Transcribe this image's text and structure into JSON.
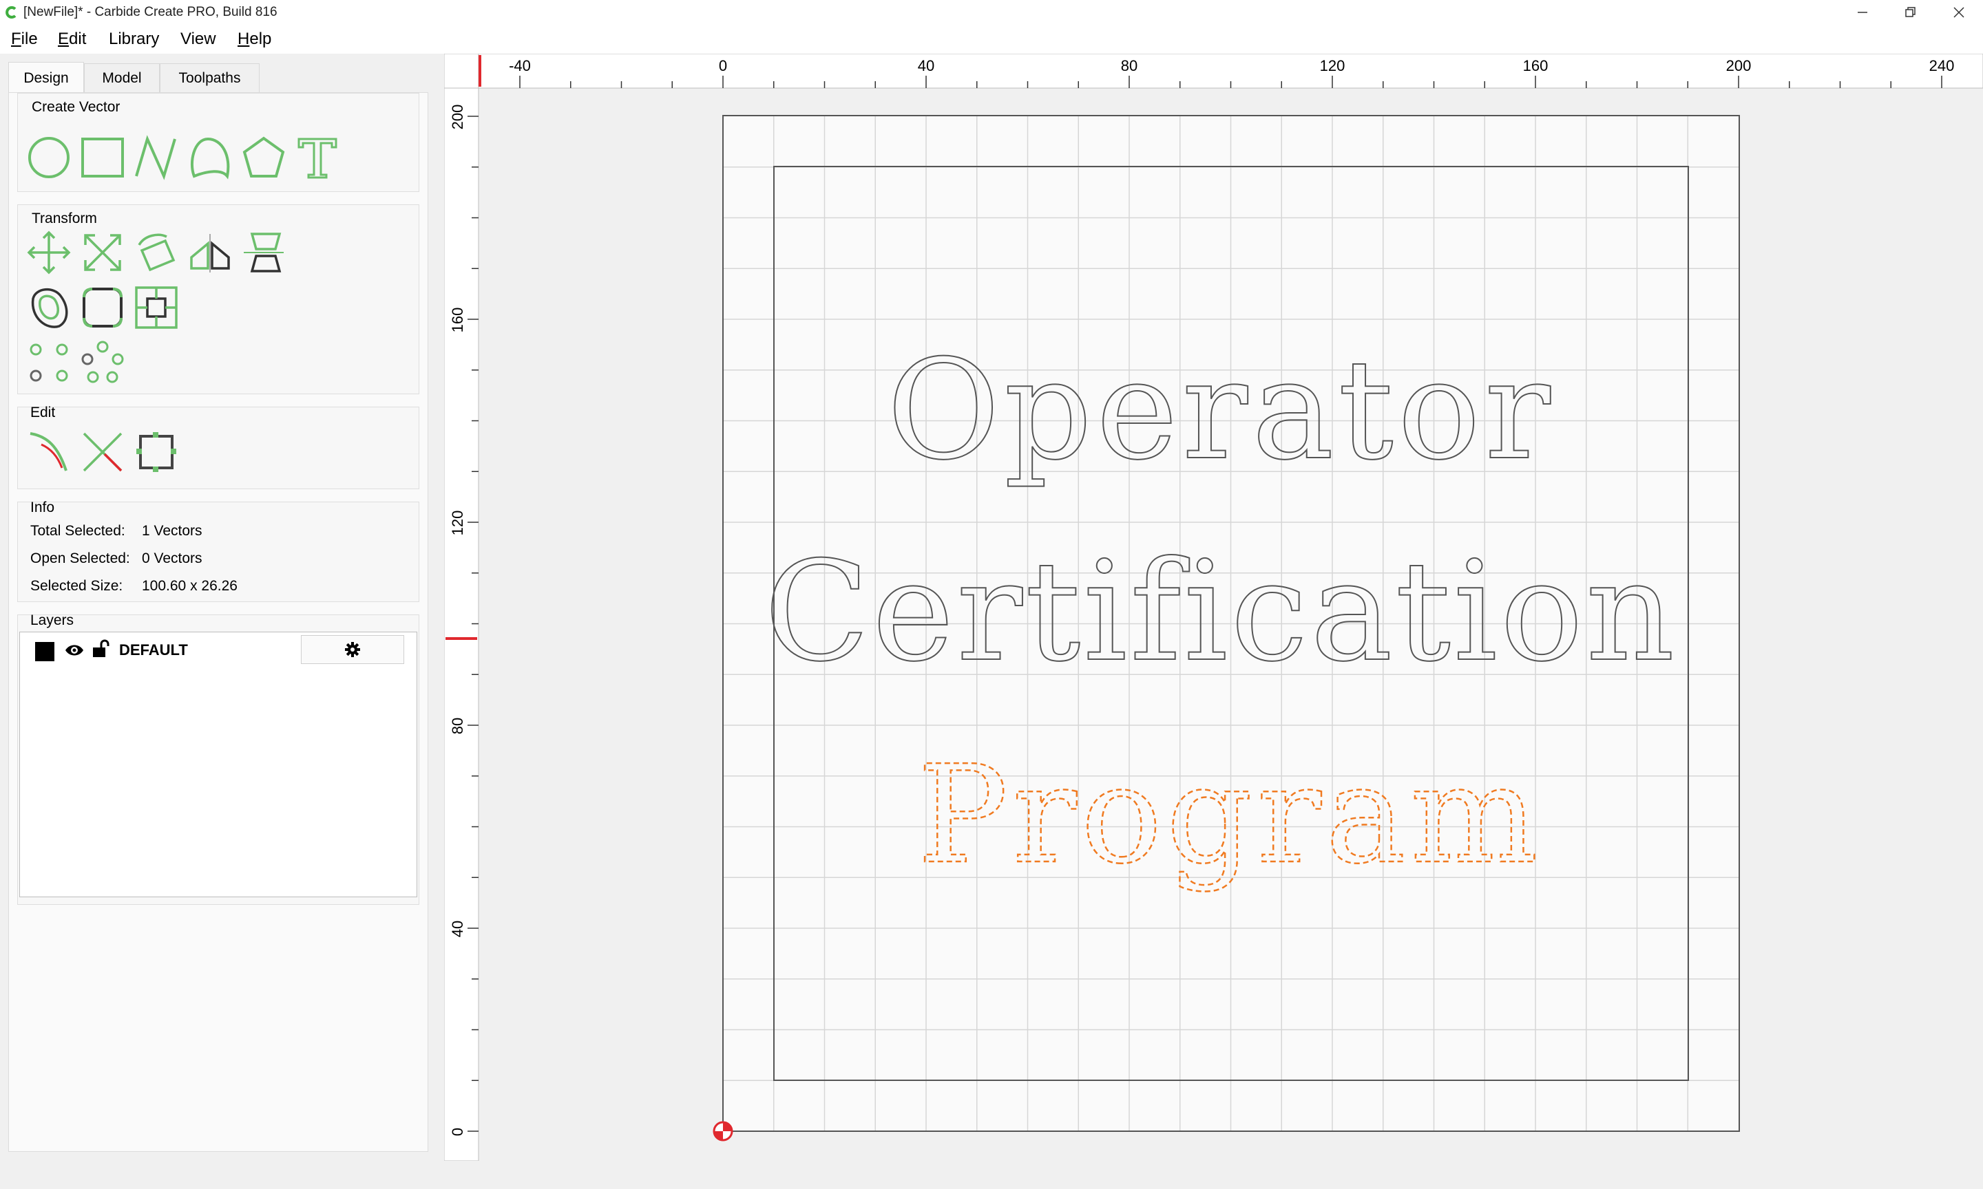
{
  "window": {
    "title": "[NewFile]* - Carbide Create PRO, Build 816",
    "minimize_icon": "minimize-icon",
    "maximize_icon": "restore-icon",
    "close_icon": "close-icon"
  },
  "menu": {
    "items": [
      {
        "label": "File",
        "accel": "F"
      },
      {
        "label": "Edit",
        "accel": "E"
      },
      {
        "label": "Library",
        "accel": ""
      },
      {
        "label": "View",
        "accel": ""
      },
      {
        "label": "Help",
        "accel": "H"
      }
    ]
  },
  "tabs": [
    {
      "label": "Design",
      "active": true
    },
    {
      "label": "Model",
      "active": false
    },
    {
      "label": "Toolpaths",
      "active": false
    }
  ],
  "groups": {
    "create_vector": {
      "title": "Create Vector",
      "tools": [
        "circle-icon",
        "rectangle-icon",
        "polyline-icon",
        "curve-icon",
        "polygon-icon",
        "text-icon"
      ]
    },
    "transform": {
      "title": "Transform",
      "tools": [
        "move-icon",
        "scale-icon",
        "rotate-icon",
        "mirror-icon",
        "align-icon",
        "offset-icon",
        "fillet-icon",
        "trim-center-icon",
        "grid-array-icon",
        "circular-array-icon"
      ]
    },
    "edit": {
      "title": "Edit",
      "tools": [
        "edit-nodes-icon",
        "trim-icon",
        "bounding-box-icon"
      ]
    },
    "info": {
      "title": "Info",
      "rows": [
        {
          "label": "Total Selected:",
          "value": "1 Vectors"
        },
        {
          "label": "Open Selected:",
          "value": "0 Vectors"
        },
        {
          "label": "Selected Size:",
          "value": "100.60 x 26.26"
        }
      ]
    },
    "layers": {
      "title": "Layers",
      "items": [
        {
          "name": "DEFAULT",
          "color": "#000000",
          "visible": true,
          "locked": false
        }
      ]
    }
  },
  "ruler": {
    "x_ticks": [
      "-40",
      "0",
      "40",
      "80",
      "120",
      "160",
      "200",
      "240"
    ],
    "y_ticks": [
      "200",
      "160",
      "120",
      "80",
      "40",
      "0"
    ]
  },
  "design": {
    "texts": [
      {
        "text": "Operator",
        "selected": false
      },
      {
        "text": "Certification",
        "selected": false
      },
      {
        "text": "Program",
        "selected": true
      }
    ],
    "stroke_color": "#555555",
    "selected_color": "#f07a20",
    "accent_green": "#6cbf6c",
    "accent_red": "#e0282e"
  }
}
